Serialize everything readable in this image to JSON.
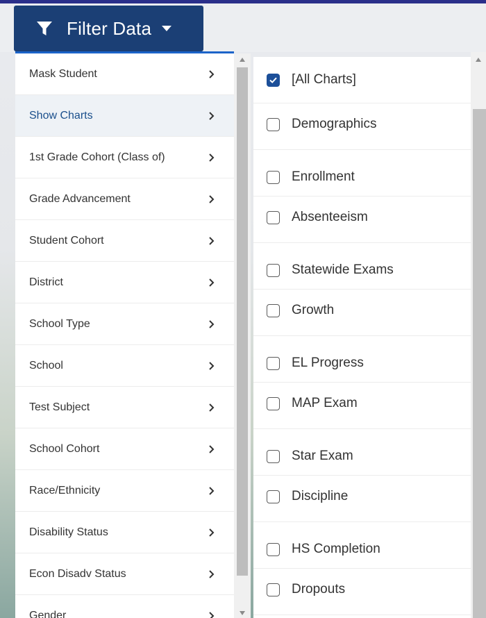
{
  "filter_button": {
    "label": "Filter Data",
    "icon": "funnel-icon"
  },
  "menu": {
    "items": [
      {
        "label": "Mask Student"
      },
      {
        "label": "Show Charts"
      },
      {
        "label": "1st Grade Cohort (Class of)"
      },
      {
        "label": "Grade Advancement"
      },
      {
        "label": "Student Cohort"
      },
      {
        "label": "District"
      },
      {
        "label": "School Type"
      },
      {
        "label": "School"
      },
      {
        "label": "Test Subject"
      },
      {
        "label": "School Cohort"
      },
      {
        "label": "Race/Ethnicity"
      },
      {
        "label": "Disability Status"
      },
      {
        "label": "Econ Disadv Status"
      },
      {
        "label": "Gender"
      }
    ],
    "active_index": 1
  },
  "charts": {
    "options": [
      {
        "label": "[All Charts]",
        "checked": true
      },
      {
        "label": "Demographics",
        "checked": false
      },
      {
        "label": "Enrollment",
        "checked": false
      },
      {
        "label": "Absenteeism",
        "checked": false
      },
      {
        "label": "Statewide Exams",
        "checked": false
      },
      {
        "label": "Growth",
        "checked": false
      },
      {
        "label": "EL Progress",
        "checked": false
      },
      {
        "label": "MAP Exam",
        "checked": false
      },
      {
        "label": "Star Exam",
        "checked": false
      },
      {
        "label": "Discipline",
        "checked": false
      },
      {
        "label": "HS Completion",
        "checked": false
      },
      {
        "label": "Dropouts",
        "checked": false
      }
    ]
  },
  "colors": {
    "button_bg": "#1b3f75",
    "accent": "#1b63c9",
    "check": "#1c4f99"
  }
}
